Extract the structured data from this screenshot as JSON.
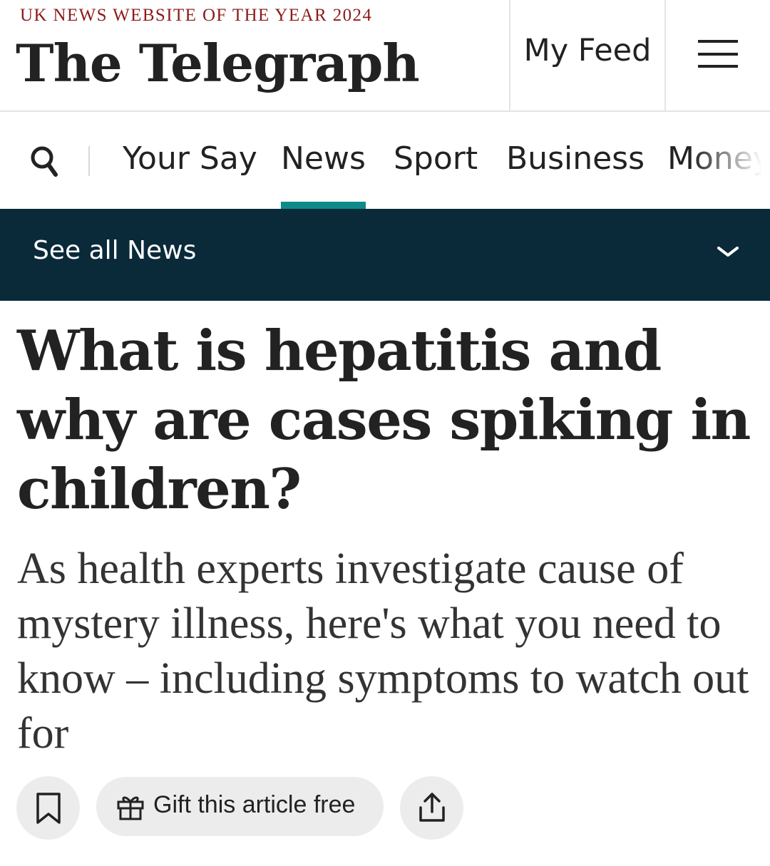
{
  "header": {
    "award": "UK NEWS WEBSITE OF THE YEAR 2024",
    "logo": "The Telegraph",
    "my_feed": "My Feed"
  },
  "nav": {
    "items": [
      {
        "label": "Your Say"
      },
      {
        "label": "News",
        "active": true
      },
      {
        "label": "Sport"
      },
      {
        "label": "Business"
      },
      {
        "label": "Money"
      }
    ]
  },
  "section_bar": {
    "label": "See all News"
  },
  "article": {
    "headline": "What is hepatitis and why are cases spiking in children?",
    "standfirst": "As health experts investigate cause of mystery illness, here's what you need to know – including symptoms to watch out for"
  },
  "actions": {
    "gift_label": "Gift this article free"
  },
  "colors": {
    "accent": "#0f8a8a",
    "section_bar": "#0a2a3a",
    "award": "#8b1a1a"
  },
  "icons": [
    "search-icon",
    "menu-icon",
    "chevron-down-icon",
    "bookmark-icon",
    "gift-icon",
    "share-icon"
  ]
}
